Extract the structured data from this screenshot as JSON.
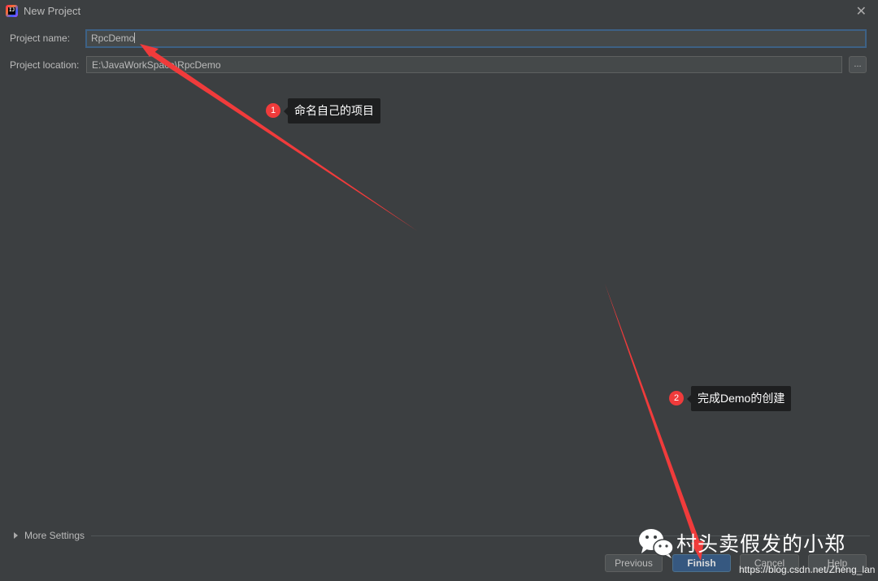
{
  "window": {
    "title": "New Project",
    "app_icon": "intellij-idea-icon",
    "close_icon": "close-icon"
  },
  "form": {
    "project_name": {
      "label": "Project name:",
      "value": "RpcDemo"
    },
    "project_location": {
      "label": "Project location:",
      "value": "E:\\JavaWorkSpace\\RpcDemo",
      "browse_label": "..."
    }
  },
  "more_settings": {
    "label": "More Settings"
  },
  "buttons": {
    "previous": "Previous",
    "finish": "Finish",
    "cancel": "Cancel",
    "help": "Help"
  },
  "annotations": [
    {
      "number": "1",
      "text": "命名自己的项目"
    },
    {
      "number": "2",
      "text": "完成Demo的创建"
    }
  ],
  "watermark": {
    "text": "村头卖假发的小郑",
    "url": "https://blog.csdn.net/Zheng_lan"
  },
  "colors": {
    "background": "#3c3f41",
    "focus_border": "#3d6185",
    "primary_button": "#365880",
    "arrow": "#f03b3b"
  }
}
